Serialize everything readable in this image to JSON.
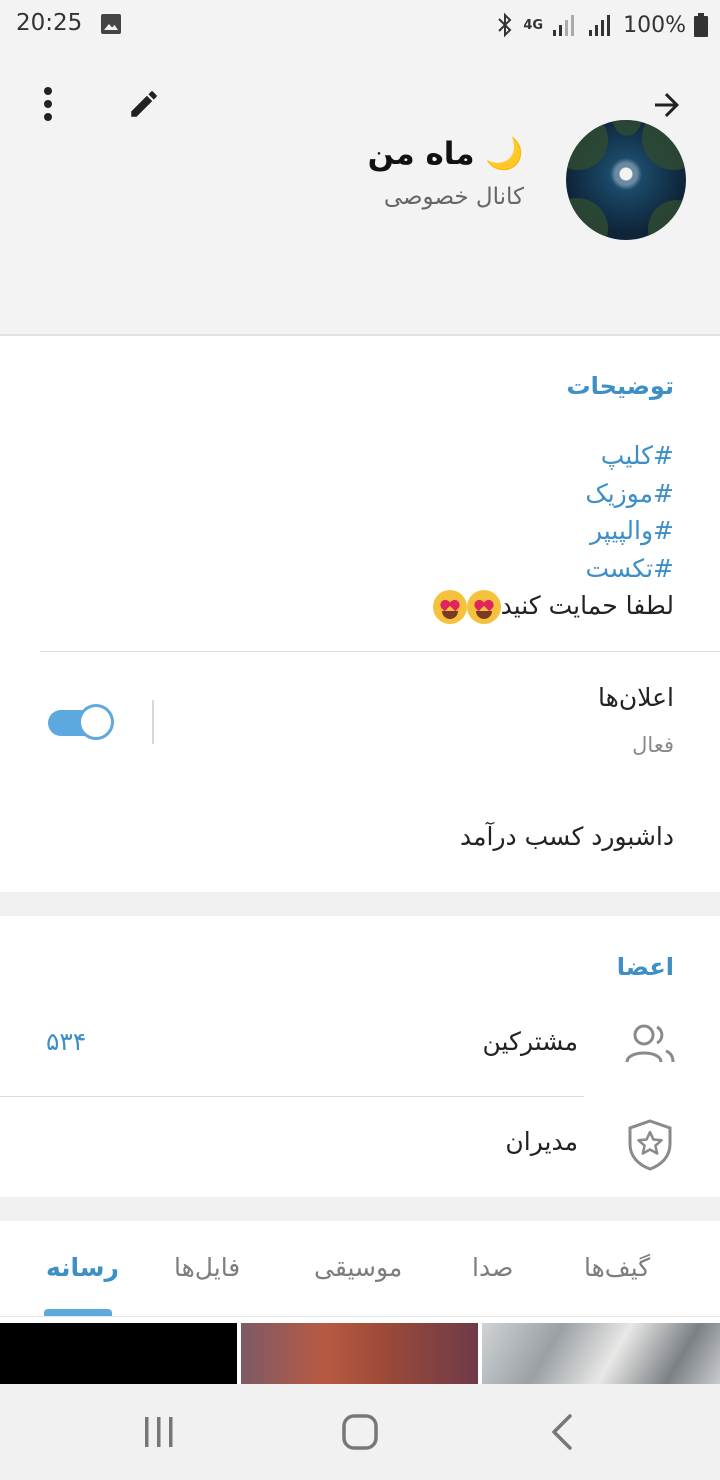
{
  "status_bar": {
    "time": "20:25",
    "network": "4G",
    "battery": "100%",
    "icons": [
      "gallery-icon",
      "bluetooth-icon",
      "signal-icon",
      "battery-icon"
    ]
  },
  "header": {
    "title": "ماه من 🌙",
    "subtitle": "کانال خصوصی",
    "icons": [
      "more-vert-icon",
      "edit-icon",
      "arrow-forward-icon"
    ]
  },
  "description": {
    "label": "توضیحات",
    "tags": [
      "#کلیپ",
      "#موزیک",
      "#والپیپر",
      "#تکست"
    ],
    "text": "لطفا حمایت کنید"
  },
  "notifications": {
    "label": "اعلان‌ها",
    "status": "فعال",
    "enabled": true
  },
  "dashboard": {
    "label": "داشبورد کسب درآمد"
  },
  "members": {
    "label": "اعضا",
    "subscribers_label": "مشترکین",
    "subscribers_count": "۵۳۴",
    "admins_label": "مدیران"
  },
  "tabs": [
    {
      "label": "رسانه",
      "active": true
    },
    {
      "label": "فایل‌ها",
      "active": false
    },
    {
      "label": "موسیقی",
      "active": false
    },
    {
      "label": "صدا",
      "active": false
    },
    {
      "label": "گیف‌ها",
      "active": false
    }
  ],
  "colors": {
    "accent": "#3d8fc6",
    "toggle": "#5ea8e0",
    "background": "#f3f3f3"
  }
}
